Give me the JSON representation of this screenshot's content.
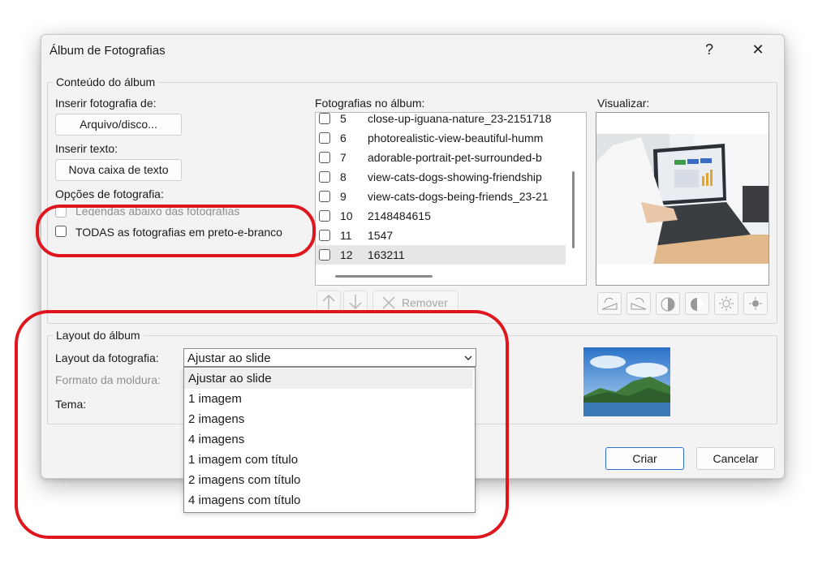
{
  "dialog": {
    "title": "Álbum de Fotografias",
    "help": "?",
    "close": "✕"
  },
  "content": {
    "legend": "Conteúdo do álbum",
    "insert_photo_from": "Inserir fotografia de:",
    "file_disk_button": "Arquivo/disco...",
    "insert_text": "Inserir texto:",
    "new_text_box_button": "Nova caixa de texto",
    "photo_options": "Opções de fotografia:",
    "captions_option": "Legendas abaixo das fotografias",
    "bw_option": "TODAS as fotografias em preto-e-branco"
  },
  "photos": {
    "label": "Fotografias no álbum:",
    "items": [
      {
        "num": "5",
        "name": "close-up-iguana-nature_23-2151718"
      },
      {
        "num": "6",
        "name": "photorealistic-view-beautiful-humm"
      },
      {
        "num": "7",
        "name": "adorable-portrait-pet-surrounded-b"
      },
      {
        "num": "8",
        "name": "view-cats-dogs-showing-friendship"
      },
      {
        "num": "9",
        "name": "view-cats-dogs-being-friends_23-21"
      },
      {
        "num": "10",
        "name": "2148484615"
      },
      {
        "num": "11",
        "name": "1547"
      },
      {
        "num": "12",
        "name": "163211"
      }
    ],
    "remove_button": "Remover"
  },
  "preview": {
    "label": "Visualizar:"
  },
  "layout": {
    "legend": "Layout do álbum",
    "photo_layout_label": "Layout da fotografia:",
    "photo_layout_value": "Ajustar ao slide",
    "frame_shape_label": "Formato da moldura:",
    "theme_label": "Tema:",
    "options": [
      "Ajustar ao slide",
      "1 imagem",
      "2 imagens",
      "4 imagens",
      "1 imagem com título",
      "2 imagens com título",
      "4 imagens com título"
    ]
  },
  "footer": {
    "create_button": "Criar",
    "cancel_button": "Cancelar"
  },
  "colors": {
    "highlight_ring": "#e0161f",
    "dialog_bg": "#f3f3f3"
  }
}
